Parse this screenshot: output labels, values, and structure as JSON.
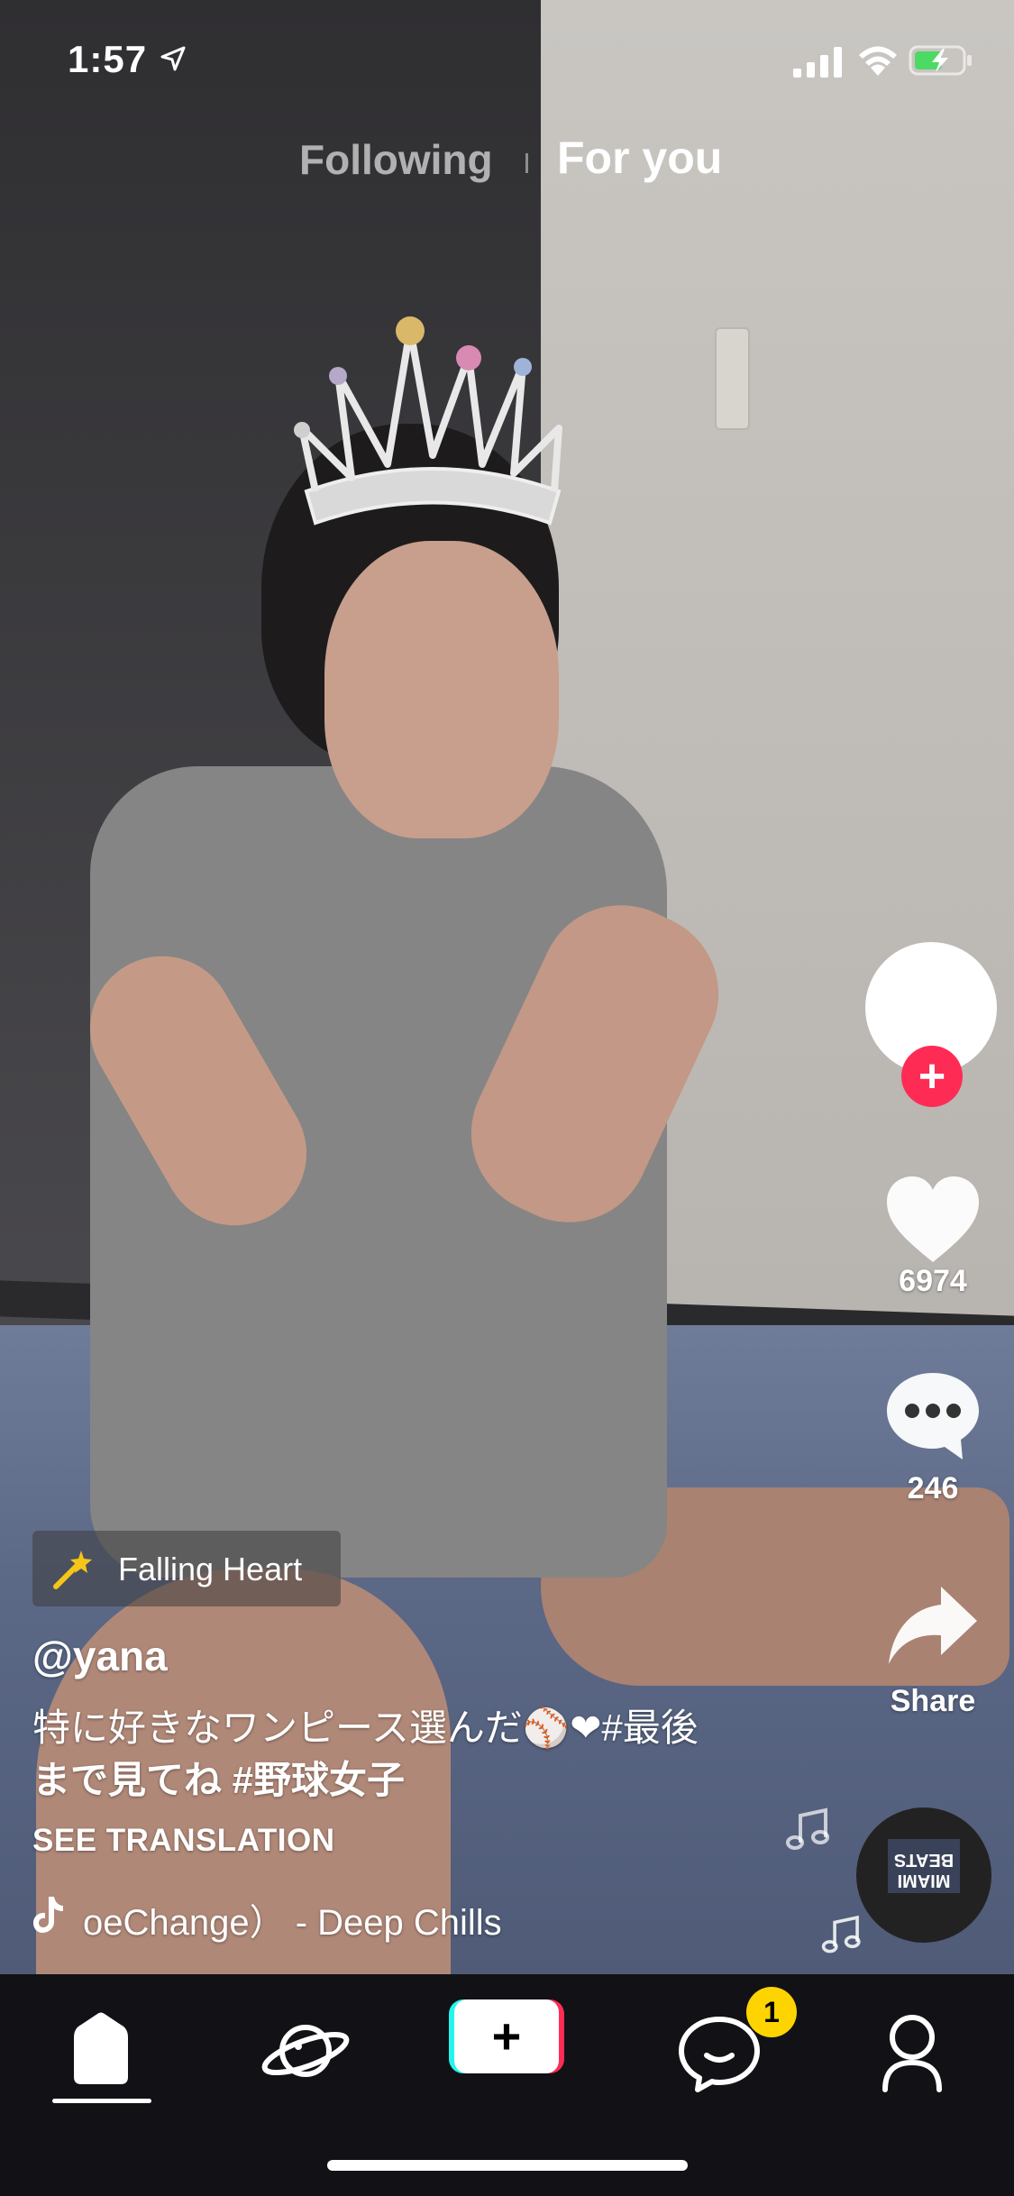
{
  "status_bar": {
    "time": "1:57",
    "icons": [
      "location-arrow-icon",
      "cellular-signal-icon",
      "wifi-icon",
      "battery-charging-icon"
    ],
    "battery_color": "#4cd964"
  },
  "top_tabs": {
    "following_label": "Following",
    "for_you_label": "For you",
    "active": "For you"
  },
  "right_rail": {
    "follow_symbol": "+",
    "like_count": "6974",
    "comment_count": "246",
    "share_label": "Share",
    "disc_text": "MIAMI BEATS",
    "accent_color": "#fe2c55"
  },
  "video_info": {
    "effect_label": "Falling Heart",
    "username": "@yana",
    "caption_line1": "特に好きなワンピース選んだ⚾❤#最後",
    "caption_line2": "まで見てね #野球女子",
    "see_translation": "SEE TRANSLATION",
    "sound_title": "oeChange）  - Deep Chills"
  },
  "tab_bar": {
    "items": [
      "home-icon",
      "discover-planet-icon",
      "create-button",
      "inbox-icon",
      "profile-icon"
    ],
    "create_symbol": "+",
    "inbox_badge": "1",
    "badge_color": "#fed400",
    "active": "home"
  }
}
